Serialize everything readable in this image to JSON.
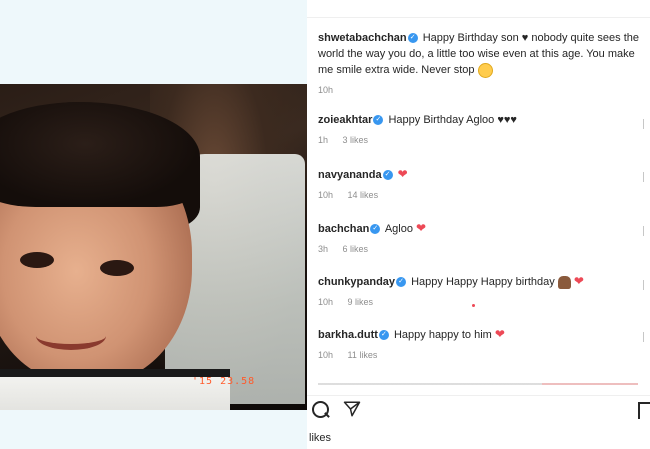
{
  "post": {
    "datestamp": "'15 23.58"
  },
  "comments": [
    {
      "user": "shwetabachchan",
      "text": "Happy Birthday son",
      "text2": "nobody quite sees the world the way you do, a little too wise even at this age. You make me smile extra wide. Never stop",
      "time": "10h"
    },
    {
      "user": "zoieakhtar",
      "text": "Happy Birthday Agloo ♥♥♥",
      "time": "1h",
      "likes": "3 likes"
    },
    {
      "user": "navyananda",
      "text": "",
      "time": "10h",
      "likes": "14 likes"
    },
    {
      "user": "bachchan",
      "text": "Agloo",
      "time": "3h",
      "likes": "6 likes"
    },
    {
      "user": "chunkypanday",
      "text": "Happy Happy Happy birthday",
      "time": "10h",
      "likes": "9 likes"
    },
    {
      "user": "barkha.dutt",
      "text": "Happy happy to him",
      "time": "10h",
      "likes": "11 likes"
    }
  ],
  "footer": {
    "likes_label": "likes"
  },
  "colors": {
    "verified": "#3897f0",
    "heart": "#ed4956",
    "meta": "#8e8e8e"
  },
  "icons": [
    "verified-badge-icon",
    "red-heart-icon",
    "search-icon",
    "send-icon",
    "bookmark-icon"
  ]
}
